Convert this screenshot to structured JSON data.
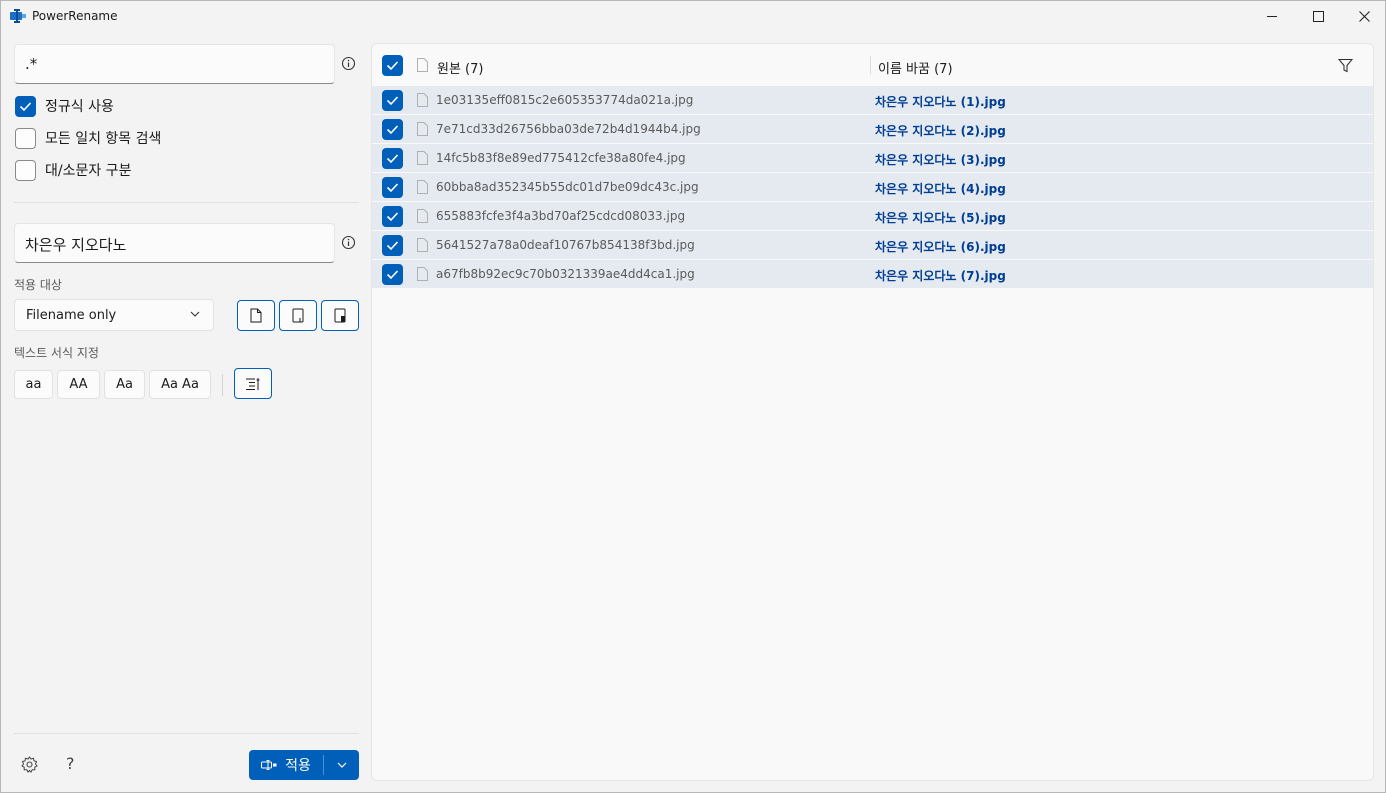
{
  "app": {
    "title": "PowerRename"
  },
  "search": {
    "value": ".*"
  },
  "options": {
    "use_regex": {
      "label": "정규식 사용",
      "checked": true
    },
    "match_all": {
      "label": "모든 일치 항목 검색",
      "checked": false
    },
    "case_sensitive": {
      "label": "대/소문자 구분",
      "checked": false
    }
  },
  "replace": {
    "value": "차은우 지오다노"
  },
  "apply_to": {
    "label": "적용 대상",
    "selected": "Filename only"
  },
  "text_format": {
    "label": "텍스트 서식 지정",
    "buttons": [
      "aa",
      "AA",
      "Aa",
      "Aa Aa"
    ]
  },
  "footer": {
    "help": "?",
    "rename_label": "적용"
  },
  "list": {
    "original_header": "원본 (7)",
    "renamed_header": "이름 바꿈 (7)",
    "rows": [
      {
        "original": "1e03135eff0815c2e605353774da021a.jpg",
        "renamed": "차은우 지오다노 (1).jpg"
      },
      {
        "original": "7e71cd33d26756bba03de72b4d1944b4.jpg",
        "renamed": "차은우 지오다노 (2).jpg"
      },
      {
        "original": "14fc5b83f8e89ed775412cfe38a80fe4.jpg",
        "renamed": "차은우 지오다노 (3).jpg"
      },
      {
        "original": "60bba8ad352345b55dc01d7be09dc43c.jpg",
        "renamed": "차은우 지오다노 (4).jpg"
      },
      {
        "original": "655883fcfe3f4a3bd70af25cdcd08033.jpg",
        "renamed": "차은우 지오다노 (5).jpg"
      },
      {
        "original": "5641527a78a0deaf10767b854138f3bd.jpg",
        "renamed": "차은우 지오다노 (6).jpg"
      },
      {
        "original": "a67fb8b92ec9c70b0321339ae4dd4ca1.jpg",
        "renamed": "차은우 지오다노 (7).jpg"
      }
    ]
  },
  "colors": {
    "accent": "#005fb8",
    "row_bg": "#e5eaf1",
    "renamed_text": "#003e92"
  }
}
